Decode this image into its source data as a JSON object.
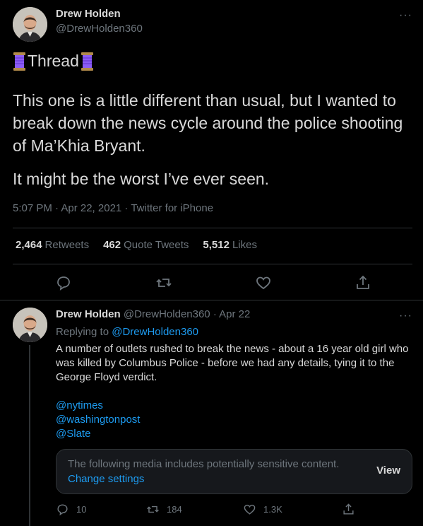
{
  "main": {
    "author_name": "Drew Holden",
    "author_handle": "@DrewHolden360",
    "thread_label": "Thread",
    "paragraph1": "This one is a little different than usual, but I wanted to break down the news cycle around the police shooting of Ma’Khia Bryant.",
    "paragraph2": "It might be the worst I’ve ever seen.",
    "meta": "5:07 PM · Apr 22, 2021 · Twitter for iPhone",
    "retweets_count": "2,464",
    "retweets_label": "Retweets",
    "quotes_count": "462",
    "quotes_label": "Quote Tweets",
    "likes_count": "5,512",
    "likes_label": "Likes",
    "more_label": "···"
  },
  "reply": {
    "author_name": "Drew Holden",
    "author_handle": "@DrewHolden360",
    "date": "· Apr 22",
    "replying_prefix": "Replying to",
    "replying_to": "@DrewHolden360",
    "text": "A number of outlets rushed to break the news - about a 16 year old girl who was killed by Columbus Police - before we had any details, tying it to the George Floyd verdict.",
    "mentions": [
      "@nytimes",
      "@washingtonpost",
      "@Slate"
    ],
    "sensitive_text": "The following media includes potentially sensitive content.",
    "change_settings": "Change settings",
    "view_label": "View",
    "reply_count": "10",
    "retweet_count": "184",
    "like_count": "1.3K",
    "more_label": "···"
  },
  "colors": {
    "background": "#000000",
    "text": "#d9d9d9",
    "secondary": "#6e767d",
    "link": "#1d9bf0",
    "divider": "#2f3336",
    "spool": "#8b5cf6"
  },
  "icons": [
    "reply-icon",
    "retweet-icon",
    "like-icon",
    "share-icon",
    "spool-of-thread-icon",
    "more-icon"
  ]
}
